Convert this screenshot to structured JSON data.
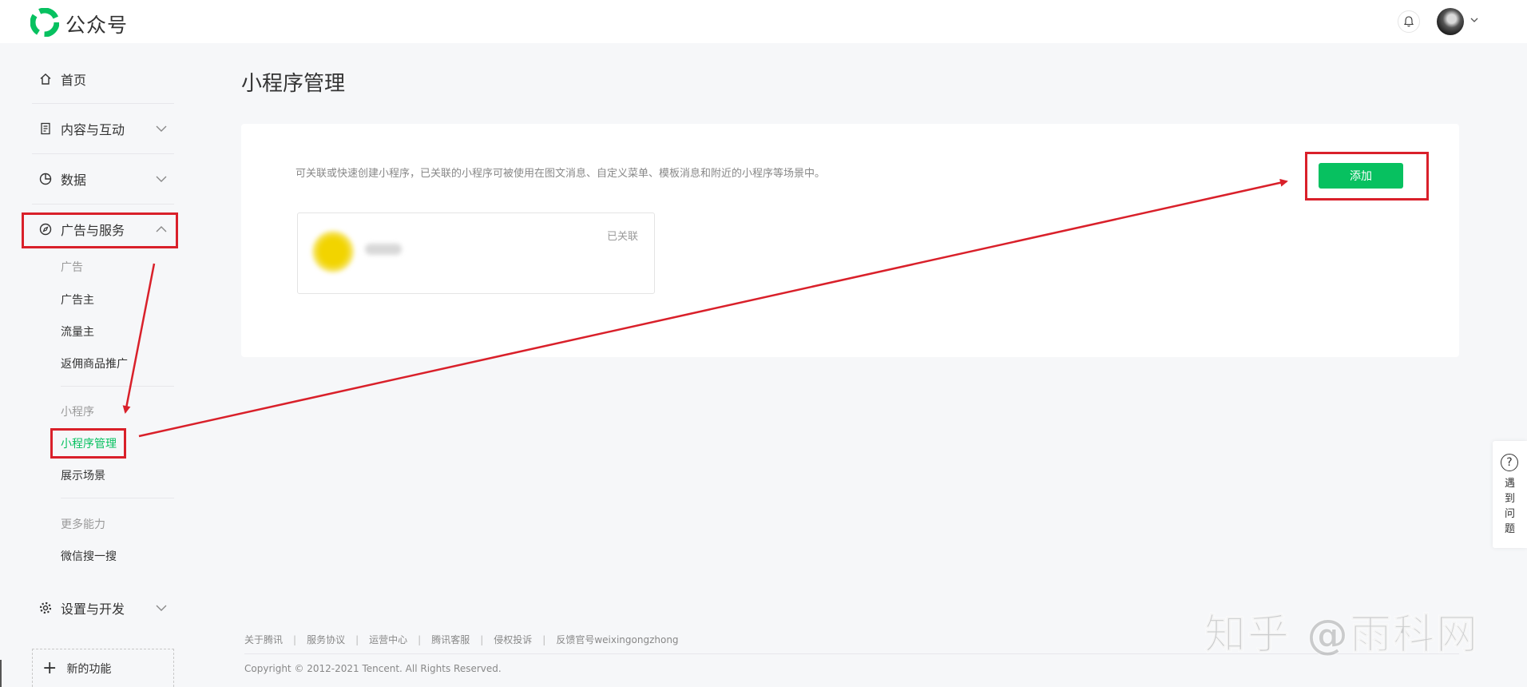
{
  "header": {
    "brand": "公众号"
  },
  "sidebar": {
    "home": "首页",
    "content": "内容与互动",
    "data": "数据",
    "ads_services": "广告与服务",
    "group_ads": "广告",
    "advertiser": "广告主",
    "traffic_owner": "流量主",
    "commission": "返佣商品推广",
    "group_mini": "小程序",
    "mini_manage": "小程序管理",
    "display_scene": "展示场景",
    "group_more": "更多能力",
    "wechat_search": "微信搜一搜",
    "settings": "设置与开发",
    "new_feature": "新的功能"
  },
  "main": {
    "title": "小程序管理",
    "description": "可关联或快速创建小程序，已关联的小程序可被使用在图文消息、自定义菜单、模板消息和附近的小程序等场景中。",
    "add_button": "添加",
    "card_status": "已关联"
  },
  "footer": {
    "links": [
      "关于腾讯",
      "服务协议",
      "运营中心",
      "腾讯客服",
      "侵权投诉",
      "反馈官号weixingongzhong"
    ],
    "copyright": "Copyright © 2012-2021 Tencent. All Rights Reserved."
  },
  "help": {
    "label": "遇到问题"
  },
  "watermark": "知乎 @雨科网",
  "colors": {
    "accent": "#07c160",
    "annotation": "#d9202a"
  }
}
